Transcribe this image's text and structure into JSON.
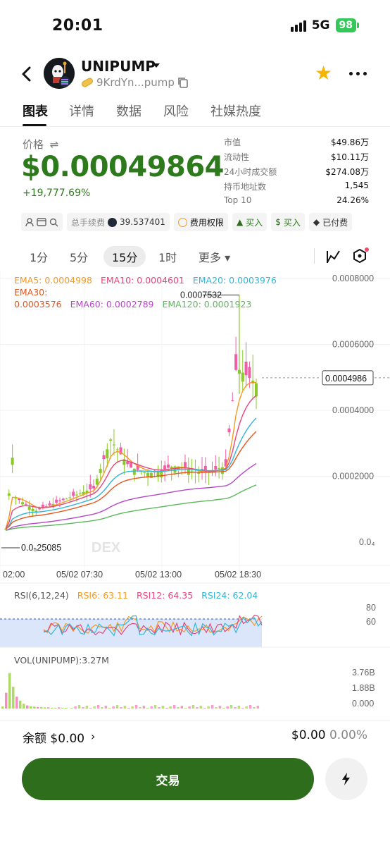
{
  "status_bar": {
    "time": "20:01",
    "network": "5G",
    "battery": "98"
  },
  "header": {
    "token_name": "UNIPUMP",
    "address": "9KrdYn...pump"
  },
  "tabs": [
    "图表",
    "详情",
    "数据",
    "风险",
    "社媒热度"
  ],
  "price": {
    "label": "价格",
    "value": "$0.00049864",
    "change": "+19,777.69%"
  },
  "stats": [
    {
      "label": "市值",
      "value": "$49.86万"
    },
    {
      "label": "流动性",
      "value": "$10.11万"
    },
    {
      "label": "24小时成交额",
      "value": "$274.08万"
    },
    {
      "label": "持币地址数",
      "value": "1,545"
    },
    {
      "label": "Top 10",
      "value": "24.26%"
    }
  ],
  "chips": {
    "fee_label": "总手续费",
    "fee_value": "39.537401",
    "fee_rights": "费用权限",
    "buy1": "买入",
    "buy2": "买入",
    "paid": "已付费"
  },
  "intervals": {
    "items": [
      "1分",
      "5分",
      "15分",
      "1时"
    ],
    "active": "15分",
    "more": "更多"
  },
  "ema_legend": {
    "ema5": "EMA5: 0.0004998",
    "ema10": "EMA10: 0.0004601",
    "ema20": "EMA20: 0.0003976",
    "ema30": "EMA30:",
    "ema30_value": "0.0003576",
    "ema60": "EMA60: 0.0002789",
    "ema120": "EMA120: 0.0001923"
  },
  "colors": {
    "ema5": "#f59a23",
    "ema10": "#e8457a",
    "ema20": "#33b5d6",
    "ema30": "#e8561a",
    "ema60": "#b548c6",
    "ema120": "#5cb85c",
    "up": "#8ac926",
    "down": "#ef5fa7",
    "brand": "#2d6d1c"
  },
  "chart_data": {
    "type": "candlestick",
    "y_ticks": [
      "0.0008000",
      "0.0006000",
      "0.0004000",
      "0.0002000",
      "0.0₄"
    ],
    "x_ticks": [
      "02:00",
      "05/02 07:30",
      "05/02 13:00",
      "05/02 18:30"
    ],
    "high_label": "0.0007532",
    "low_label": "0.0₅25085",
    "current_price_label": "0.0004986",
    "ylim": [
      0.0,
      0.00082
    ],
    "watermark": "DEX"
  },
  "rsi": {
    "title": "RSI(6,12,24)",
    "rsi6": "RSI6: 63.11",
    "rsi12": "RSI12: 64.35",
    "rsi24": "RSI24: 62.04",
    "levels": [
      "80",
      "60"
    ]
  },
  "volume": {
    "title": "VOL(UNIPUMP):3.27M",
    "ticks": [
      "3.76B",
      "1.88B",
      "0.000"
    ]
  },
  "balance": {
    "label": "余额 $0.00",
    "value": "$0.00",
    "pct": "0.00%"
  },
  "trade_label": "交易"
}
